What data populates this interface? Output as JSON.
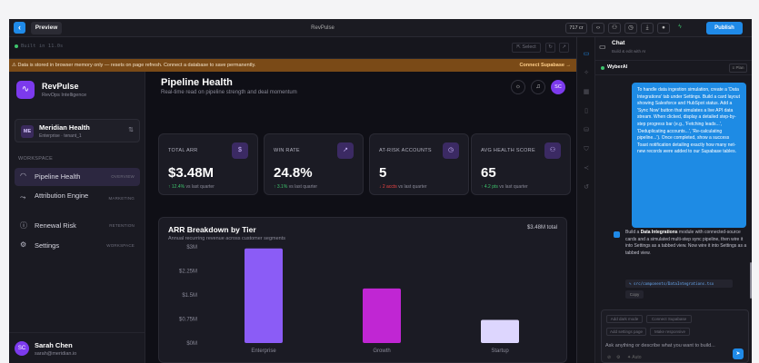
{
  "topbar": {
    "preview_tab": "Preview",
    "project_title": "RevPulse",
    "credits": "717 cr",
    "publish_label": "Publish"
  },
  "statusbar": {
    "built": "Built in 11.0s",
    "select_label": "Select"
  },
  "warning": {
    "text": "Data is stored in browser memory only — resets on page refresh. Connect a database to save permanently.",
    "action": "Connect Supabase →"
  },
  "sidebar": {
    "brand_name": "RevPulse",
    "brand_sub": "RevOps Intelligence",
    "org_initials": "ME",
    "org_name": "Meridian Health",
    "org_tenant": "Enterprise · tenant_1",
    "section_label": "WORKSPACE",
    "items": [
      {
        "label": "Pipeline Health",
        "tag": "OVERVIEW"
      },
      {
        "label": "Attribution Engine",
        "tag": "MARKETING"
      },
      {
        "label": "Renewal Risk",
        "tag": "RETENTION"
      },
      {
        "label": "Settings",
        "tag": "WORKSPACE"
      }
    ],
    "user_initials": "SC",
    "user_name": "Sarah Chen",
    "user_email": "sarah@meridian.io"
  },
  "header": {
    "title": "Pipeline Health",
    "subtitle": "Real-time read on pipeline strength and deal momentum",
    "avatar": "SC"
  },
  "cards": [
    {
      "label": "TOTAL ARR",
      "value": "$3.48M",
      "delta": "↑ 12.4%",
      "note": "vs last quarter",
      "icon": "$",
      "trend": "up"
    },
    {
      "label": "WIN RATE",
      "value": "24.8%",
      "delta": "↑ 3.1%",
      "note": "vs last quarter",
      "icon": "↗",
      "trend": "up"
    },
    {
      "label": "AT-RISK ACCOUNTS",
      "value": "5",
      "delta": "↓ 2 accts",
      "note": "vs last quarter",
      "icon": "◷",
      "trend": "down"
    },
    {
      "label": "AVG HEALTH SCORE",
      "value": "65",
      "delta": "↑ 4.2 pts",
      "note": "vs last quarter",
      "icon": "⚇",
      "trend": "up"
    }
  ],
  "chart_card": {
    "title": "ARR Breakdown by Tier",
    "subtitle": "Annual recurring revenue across customer segments",
    "total": "$3.48M total"
  },
  "chart_data": {
    "type": "bar",
    "categories": [
      "Enterprise",
      "Growth",
      "Startup"
    ],
    "values": [
      2.95,
      1.7,
      0.72
    ],
    "y_ticks": [
      "$0M",
      "$0.75M",
      "$1.5M",
      "$2.25M",
      "$3M"
    ],
    "ylim": [
      0,
      3
    ],
    "colors": [
      "#8b5cf6",
      "#c026d3",
      "#ddd6fe"
    ],
    "grid": false
  },
  "chat": {
    "title": "Chat",
    "subtitle": "Build & edit with AI",
    "agent": "WyberAI",
    "plan": "Plan",
    "user_message": "To handle data ingestion simulation, create a 'Data Integrations' tab under Settings. Build a card layout showing Salesforce and HubSpot status. Add a 'Sync Now' button that simulates a live API data stream. When clicked, display a detailed step-by-step progress bar (e.g., 'Fetching leads...', 'Deduplicating accounts...', 'Re-calculating pipeline...'). Once completed, show a success Toast notification detailing exactly how many net-new records were added to our Supabase tables.",
    "bot_prefix": "Build a ",
    "bot_bold": "Data Integrations",
    "bot_rest": " module with connected-source cards and a simulated multi-step sync pipeline, then wire it into Settings as a tabbed view. Now wire it into Settings as a tabbed view.",
    "file": "✎ src/components/DataIntegrations.tsx",
    "copy": "Copy",
    "chips": [
      "Add dark mode",
      "Connect Supabase",
      "Add settings page",
      "Make responsive"
    ],
    "placeholder": "Ask anything or describe what you want to build...",
    "auto": "✦ Auto"
  }
}
